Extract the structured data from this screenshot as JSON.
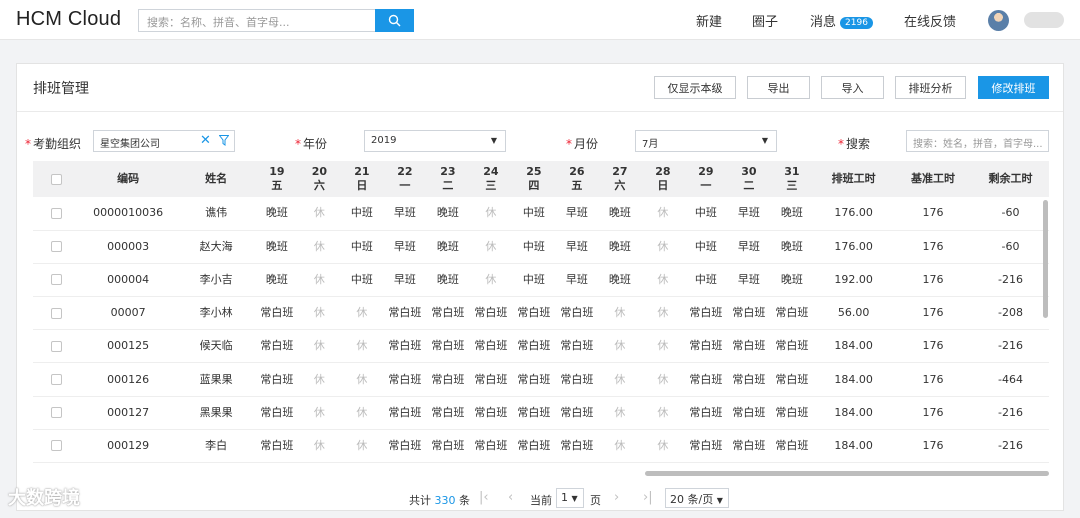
{
  "header": {
    "brand": "HCM Cloud",
    "search_placeholder": "搜索：名称、拼音、首字母...",
    "nav": {
      "new": "新建",
      "circle": "圈子",
      "messages": "消息",
      "messages_count": "2196",
      "feedback": "在线反馈"
    }
  },
  "page": {
    "title": "排班管理",
    "buttons": {
      "show_self": "仅显示本级",
      "export": "导出",
      "import": "导入",
      "analysis": "排班分析",
      "modify": "修改排班"
    }
  },
  "filters": {
    "org_label": "考勤组织",
    "org_value": "星空集团公司",
    "year_label": "年份",
    "year_value": "2019",
    "month_label": "月份",
    "month_value": "7月",
    "search_label": "搜索",
    "search_placeholder": "搜索：姓名，拼音，首字母..."
  },
  "table": {
    "col_code": "编码",
    "col_name": "姓名",
    "day_cols": [
      {
        "d": "19",
        "w": "五"
      },
      {
        "d": "20",
        "w": "六"
      },
      {
        "d": "21",
        "w": "日"
      },
      {
        "d": "22",
        "w": "一"
      },
      {
        "d": "23",
        "w": "二"
      },
      {
        "d": "24",
        "w": "三"
      },
      {
        "d": "25",
        "w": "四"
      },
      {
        "d": "26",
        "w": "五"
      },
      {
        "d": "27",
        "w": "六"
      },
      {
        "d": "28",
        "w": "日"
      },
      {
        "d": "29",
        "w": "一"
      },
      {
        "d": "30",
        "w": "二"
      },
      {
        "d": "31",
        "w": "三"
      }
    ],
    "col_sched_hours": "排班工时",
    "col_base_hours": "基准工时",
    "col_remain_hours": "剩余工时",
    "rows": [
      {
        "code": "0000010036",
        "name": "谯伟",
        "shifts": [
          "晚班",
          "休",
          "中班",
          "早班",
          "晚班",
          "休",
          "中班",
          "早班",
          "晚班",
          "休",
          "中班",
          "早班",
          "晚班"
        ],
        "sched": "176.00",
        "base": "176",
        "remain": "-60"
      },
      {
        "code": "000003",
        "name": "赵大海",
        "shifts": [
          "晚班",
          "休",
          "中班",
          "早班",
          "晚班",
          "休",
          "中班",
          "早班",
          "晚班",
          "休",
          "中班",
          "早班",
          "晚班"
        ],
        "sched": "176.00",
        "base": "176",
        "remain": "-60"
      },
      {
        "code": "000004",
        "name": "李小吉",
        "shifts": [
          "晚班",
          "休",
          "中班",
          "早班",
          "晚班",
          "休",
          "中班",
          "早班",
          "晚班",
          "休",
          "中班",
          "早班",
          "晚班"
        ],
        "sched": "192.00",
        "base": "176",
        "remain": "-216"
      },
      {
        "code": "00007",
        "name": "李小林",
        "shifts": [
          "常白班",
          "休",
          "休",
          "常白班",
          "常白班",
          "常白班",
          "常白班",
          "常白班",
          "休",
          "休",
          "常白班",
          "常白班",
          "常白班"
        ],
        "sched": "56.00",
        "base": "176",
        "remain": "-208"
      },
      {
        "code": "000125",
        "name": "候天临",
        "shifts": [
          "常白班",
          "休",
          "休",
          "常白班",
          "常白班",
          "常白班",
          "常白班",
          "常白班",
          "休",
          "休",
          "常白班",
          "常白班",
          "常白班"
        ],
        "sched": "184.00",
        "base": "176",
        "remain": "-216"
      },
      {
        "code": "000126",
        "name": "蓝果果",
        "shifts": [
          "常白班",
          "休",
          "休",
          "常白班",
          "常白班",
          "常白班",
          "常白班",
          "常白班",
          "休",
          "休",
          "常白班",
          "常白班",
          "常白班"
        ],
        "sched": "184.00",
        "base": "176",
        "remain": "-464"
      },
      {
        "code": "000127",
        "name": "黑果果",
        "shifts": [
          "常白班",
          "休",
          "休",
          "常白班",
          "常白班",
          "常白班",
          "常白班",
          "常白班",
          "休",
          "休",
          "常白班",
          "常白班",
          "常白班"
        ],
        "sched": "184.00",
        "base": "176",
        "remain": "-216"
      },
      {
        "code": "000129",
        "name": "李白",
        "shifts": [
          "常白班",
          "休",
          "休",
          "常白班",
          "常白班",
          "常白班",
          "常白班",
          "常白班",
          "休",
          "休",
          "常白班",
          "常白班",
          "常白班"
        ],
        "sched": "184.00",
        "base": "176",
        "remain": "-216"
      }
    ]
  },
  "pager": {
    "total_prefix": "共计",
    "total": "330",
    "total_suffix": "条",
    "current_label": "当前",
    "current_page": "1",
    "page_suffix": "页",
    "page_size": "20 条/页"
  },
  "watermark": "大数跨境",
  "colors": {
    "accent": "#1a96e6",
    "rest_text": "#bbbbbb"
  }
}
